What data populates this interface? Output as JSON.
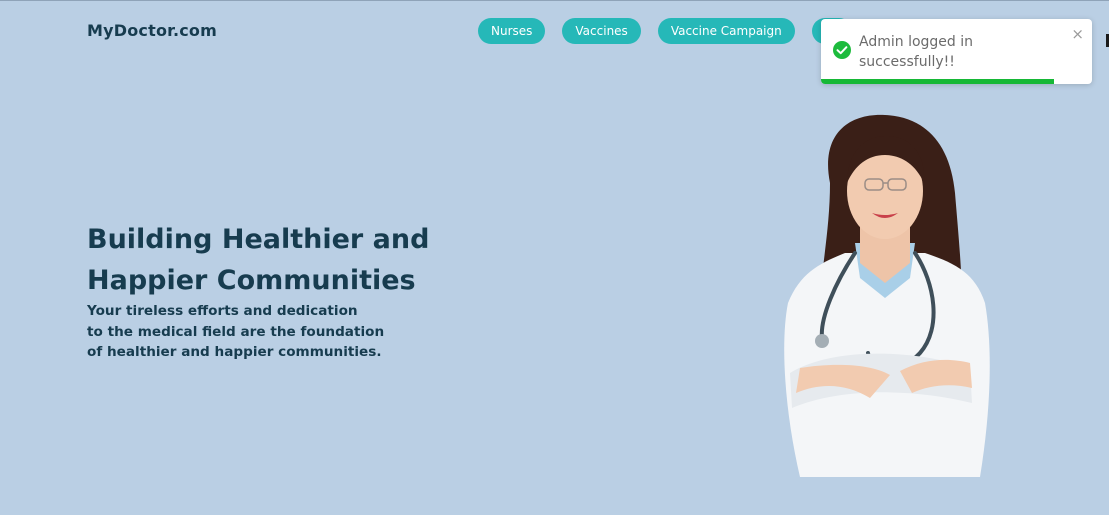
{
  "brand": "MyDoctor.com",
  "nav": {
    "items": [
      "Nurses",
      "Vaccines",
      "Vaccine Campaign",
      ""
    ]
  },
  "hero": {
    "title_line1": "Building Healthier and",
    "title_line2": "Happier Communities",
    "sub_line1": "Your tireless efforts and dedication",
    "sub_line2": "to the medical field are the foundation",
    "sub_line3": "of healthier and happier communities."
  },
  "toast": {
    "message": "Admin logged in successfully!!",
    "close_icon": "×",
    "icon": "check-circle-icon",
    "progress": 0.86,
    "color": "#16b836"
  },
  "colors": {
    "background": "#bacfe4",
    "accent": "#26b8b8",
    "text": "#173c4f"
  }
}
